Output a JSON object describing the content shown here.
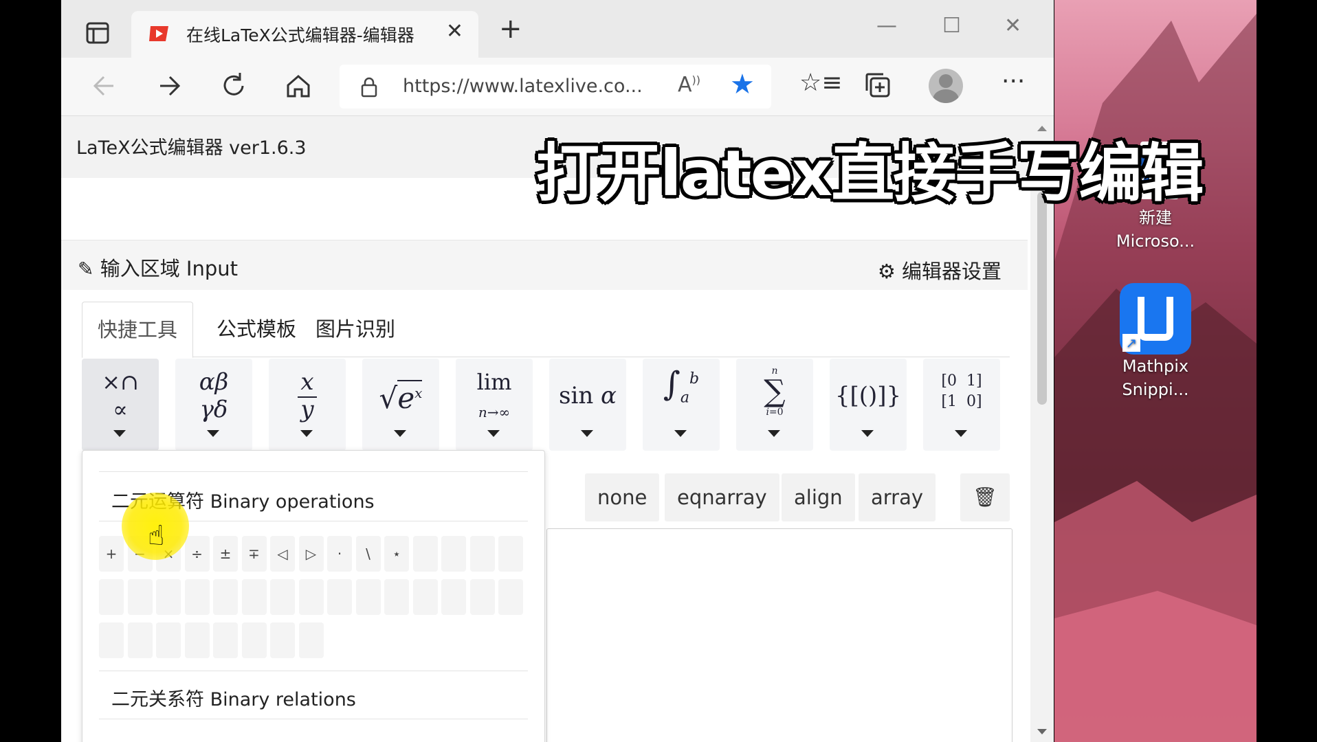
{
  "browser": {
    "tab_title": "在线LaTeX公式编辑器-编辑器",
    "url": "https://www.latexlive.co...",
    "read_aloud": "A̅"
  },
  "app": {
    "title": "LaTeX公式编辑器 ver1.6.3",
    "input_title": "输入区域 Input",
    "settings_label": "编辑器设置"
  },
  "tabs": [
    "快捷工具",
    "公式模板",
    "图片识别"
  ],
  "env_buttons": [
    "none",
    "eqnarray",
    "align",
    "array"
  ],
  "dropdown": {
    "section1": "二元运算符 Binary operations",
    "section2": "二元关系符 Binary relations",
    "symbols": [
      "+",
      "−",
      "×",
      "÷",
      "±",
      "∓",
      "◁",
      "▷",
      "·",
      "\\",
      "⋆"
    ]
  },
  "caption": "打开latex直接手写编辑",
  "desktop": {
    "icon1_line1": "新建",
    "icon1_line2": "Microso...",
    "icon2_line1": "Mathpix",
    "icon2_line2": "Snippi..."
  },
  "colors": {
    "star": "#1a73e8",
    "glow": "#ffeb00",
    "favicon": "#e8392c"
  }
}
